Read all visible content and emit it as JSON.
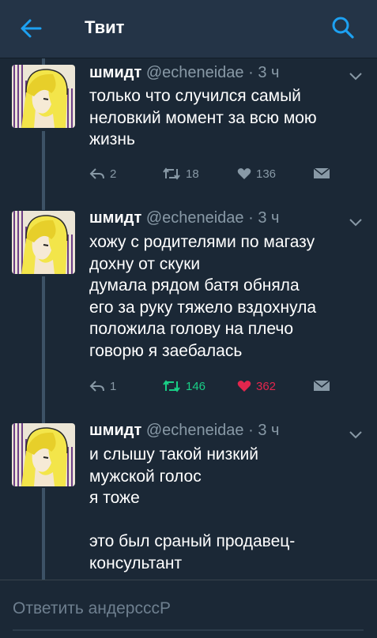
{
  "header": {
    "title": "Твит",
    "back_icon": "arrow-left-icon",
    "search_icon": "search-icon",
    "accent_color": "#1da1f2"
  },
  "tweets": [
    {
      "name": "шмидт",
      "handle": "@echeneidae",
      "time": "· 3 ч",
      "lines": [
        "только что случился самый",
        "неловкий момент за всю мою",
        "жизнь"
      ],
      "replies": "2",
      "retweets": "18",
      "likes": "136",
      "retweeted": false,
      "liked": false
    },
    {
      "name": "шмидт",
      "handle": "@echeneidae",
      "time": "· 3 ч",
      "lines": [
        "хожу с родителями по магазу",
        "дохну от скуки",
        "думала рядом батя обняла",
        "его за руку тяжело вздохнула",
        "положила голову на плечо",
        "говорю я заебалась"
      ],
      "replies": "1",
      "retweets": "146",
      "likes": "362",
      "retweeted": true,
      "liked": true
    },
    {
      "name": "шмидт",
      "handle": "@echeneidae",
      "time": "· 3 ч",
      "lines": [
        "и слышу такой низкий",
        "мужской голос",
        "я тоже",
        "",
        "это был сраный продавец-",
        "консультант"
      ]
    }
  ],
  "colors": {
    "retweet_active": "#19cf86",
    "like_active": "#e2264d",
    "muted": "#8899a6"
  },
  "reply": {
    "placeholder": "Ответить андерсссР"
  }
}
